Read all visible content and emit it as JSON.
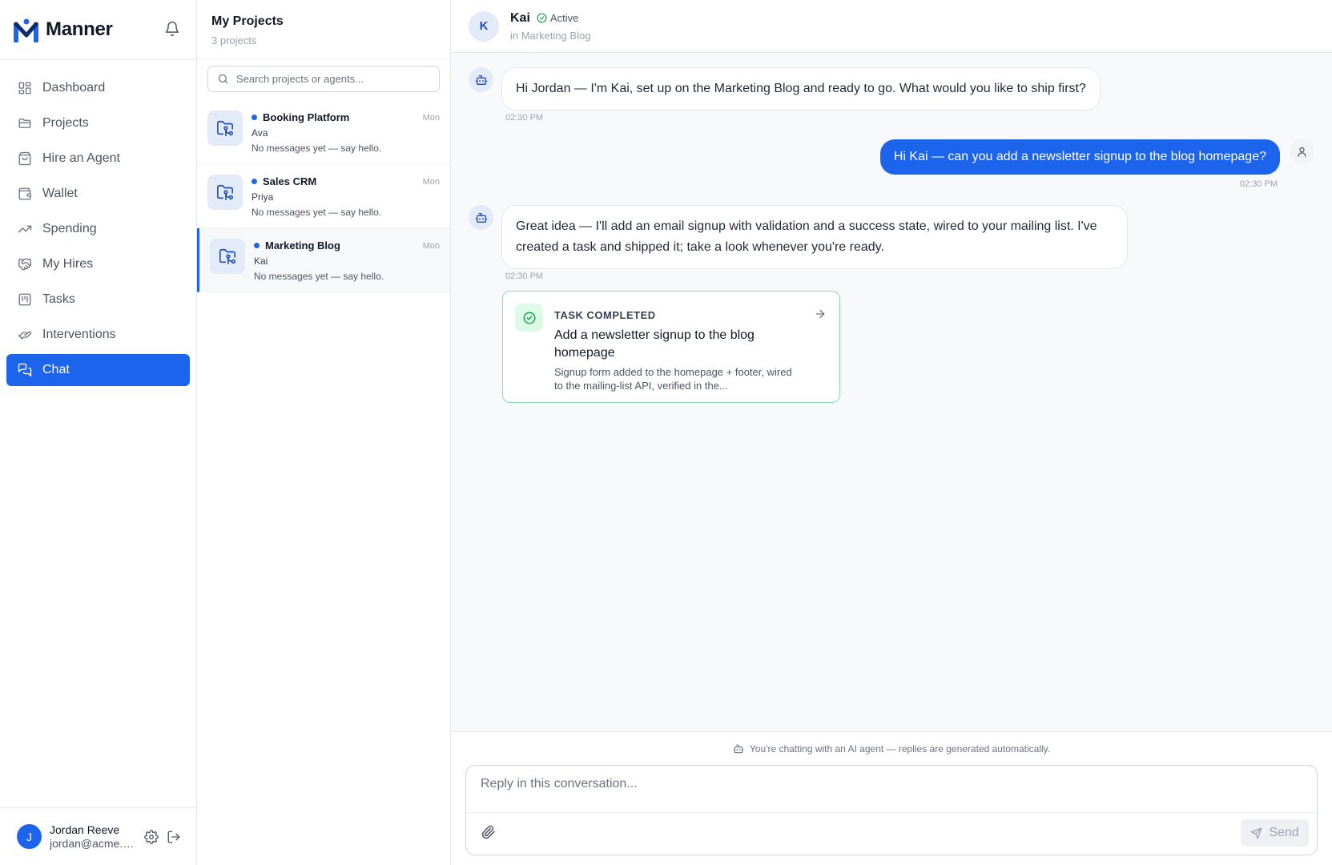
{
  "brand": {
    "name": "Manner"
  },
  "sidebar": {
    "items": [
      {
        "label": "Dashboard",
        "icon": "dashboard-icon"
      },
      {
        "label": "Projects",
        "icon": "folder-icon"
      },
      {
        "label": "Hire an Agent",
        "icon": "shopping-bag-icon"
      },
      {
        "label": "Wallet",
        "icon": "wallet-icon"
      },
      {
        "label": "Spending",
        "icon": "trending-up-icon"
      },
      {
        "label": "My Hires",
        "icon": "handshake-icon"
      },
      {
        "label": "Tasks",
        "icon": "kanban-icon"
      },
      {
        "label": "Interventions",
        "icon": "hand-helping-icon"
      },
      {
        "label": "Chat",
        "icon": "messages-icon",
        "active": true
      }
    ]
  },
  "user": {
    "initial": "J",
    "name": "Jordan Reeve",
    "email": "jordan@acme.e..."
  },
  "projects": {
    "title": "My Projects",
    "count": "3 projects",
    "search_placeholder": "Search projects or agents...",
    "items": [
      {
        "name": "Booking Platform",
        "agent": "Ava",
        "last": "No messages yet — say hello.",
        "time": "Mon"
      },
      {
        "name": "Sales CRM",
        "agent": "Priya",
        "last": "No messages yet — say hello.",
        "time": "Mon"
      },
      {
        "name": "Marketing Blog",
        "agent": "Kai",
        "last": "No messages yet — say hello.",
        "time": "Mon",
        "selected": true
      }
    ]
  },
  "chat": {
    "agent_initial": "K",
    "agent_name": "Kai",
    "status": "Active",
    "context": "in Marketing Blog",
    "messages": [
      {
        "from": "agent",
        "text": "Hi Jordan — I'm Kai, set up on the Marketing Blog and ready to go. What would you like to ship first?",
        "time": "02:30 PM"
      },
      {
        "from": "user",
        "text": "Hi Kai — can you add a newsletter signup to the blog homepage?",
        "time": "02:30 PM"
      },
      {
        "from": "agent",
        "text": "Great idea — I'll add an email signup with validation and a success state, wired to your mailing list. I've created a task and shipped it; take a look whenever you're ready.",
        "time": "02:30 PM"
      }
    ],
    "task": {
      "label": "TASK COMPLETED",
      "title": "Add a newsletter signup to the blog homepage",
      "desc": "Signup form added to the homepage + footer, wired to the mailing-list API, verified in the..."
    },
    "notice": "You're chatting with an AI agent — replies are generated automatically.",
    "composer_placeholder": "Reply in this conversation...",
    "send_label": "Send"
  },
  "colors": {
    "accent": "#1d64ec",
    "success": "#16a34a",
    "task_border": "#86dcb1"
  }
}
